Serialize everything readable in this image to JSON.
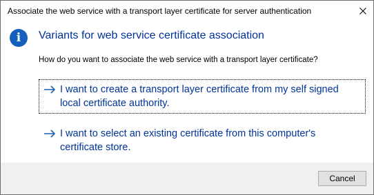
{
  "window": {
    "title": "Associate the web service with a transport layer certificate for server authentication"
  },
  "dialog": {
    "heading": "Variants for web service certificate association",
    "question": "How do you want to associate the web service with a transport layer certificate?",
    "options": [
      {
        "label": "I want to create a transport layer certificate from my self signed local certificate authority.",
        "icon": "arrow-right-icon"
      },
      {
        "label": "I want to select an existing certificate from this computer's certificate store.",
        "icon": "arrow-right-icon"
      }
    ],
    "info_icon": "info-icon",
    "info_glyph": "i"
  },
  "footer": {
    "cancel_label": "Cancel"
  },
  "colors": {
    "link": "#003399",
    "info_icon_bg": "#1560bd",
    "footer_bg": "#f0f0f0"
  }
}
